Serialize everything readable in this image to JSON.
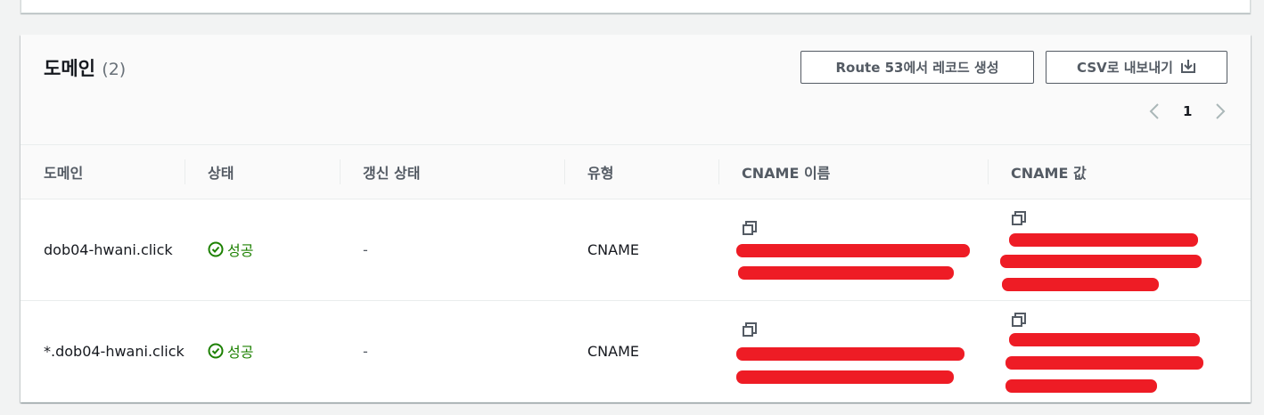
{
  "header": {
    "title": "도메인",
    "count": "(2)",
    "route53_button": "Route 53에서 레코드 생성",
    "csv_button": "CSV로 내보내기",
    "page": "1"
  },
  "table": {
    "columns": [
      "도메인",
      "상태",
      "갱신 상태",
      "유형",
      "CNAME 이름",
      "CNAME 값"
    ],
    "rows": [
      {
        "domain": "dob04-hwani.click",
        "status": "성공",
        "renewal": "-",
        "type": "CNAME"
      },
      {
        "domain": "*.dob04-hwani.click",
        "status": "성공",
        "renewal": "-",
        "type": "CNAME"
      }
    ]
  },
  "colors": {
    "success": "#1d8102",
    "redaction": "#ee1c25"
  }
}
